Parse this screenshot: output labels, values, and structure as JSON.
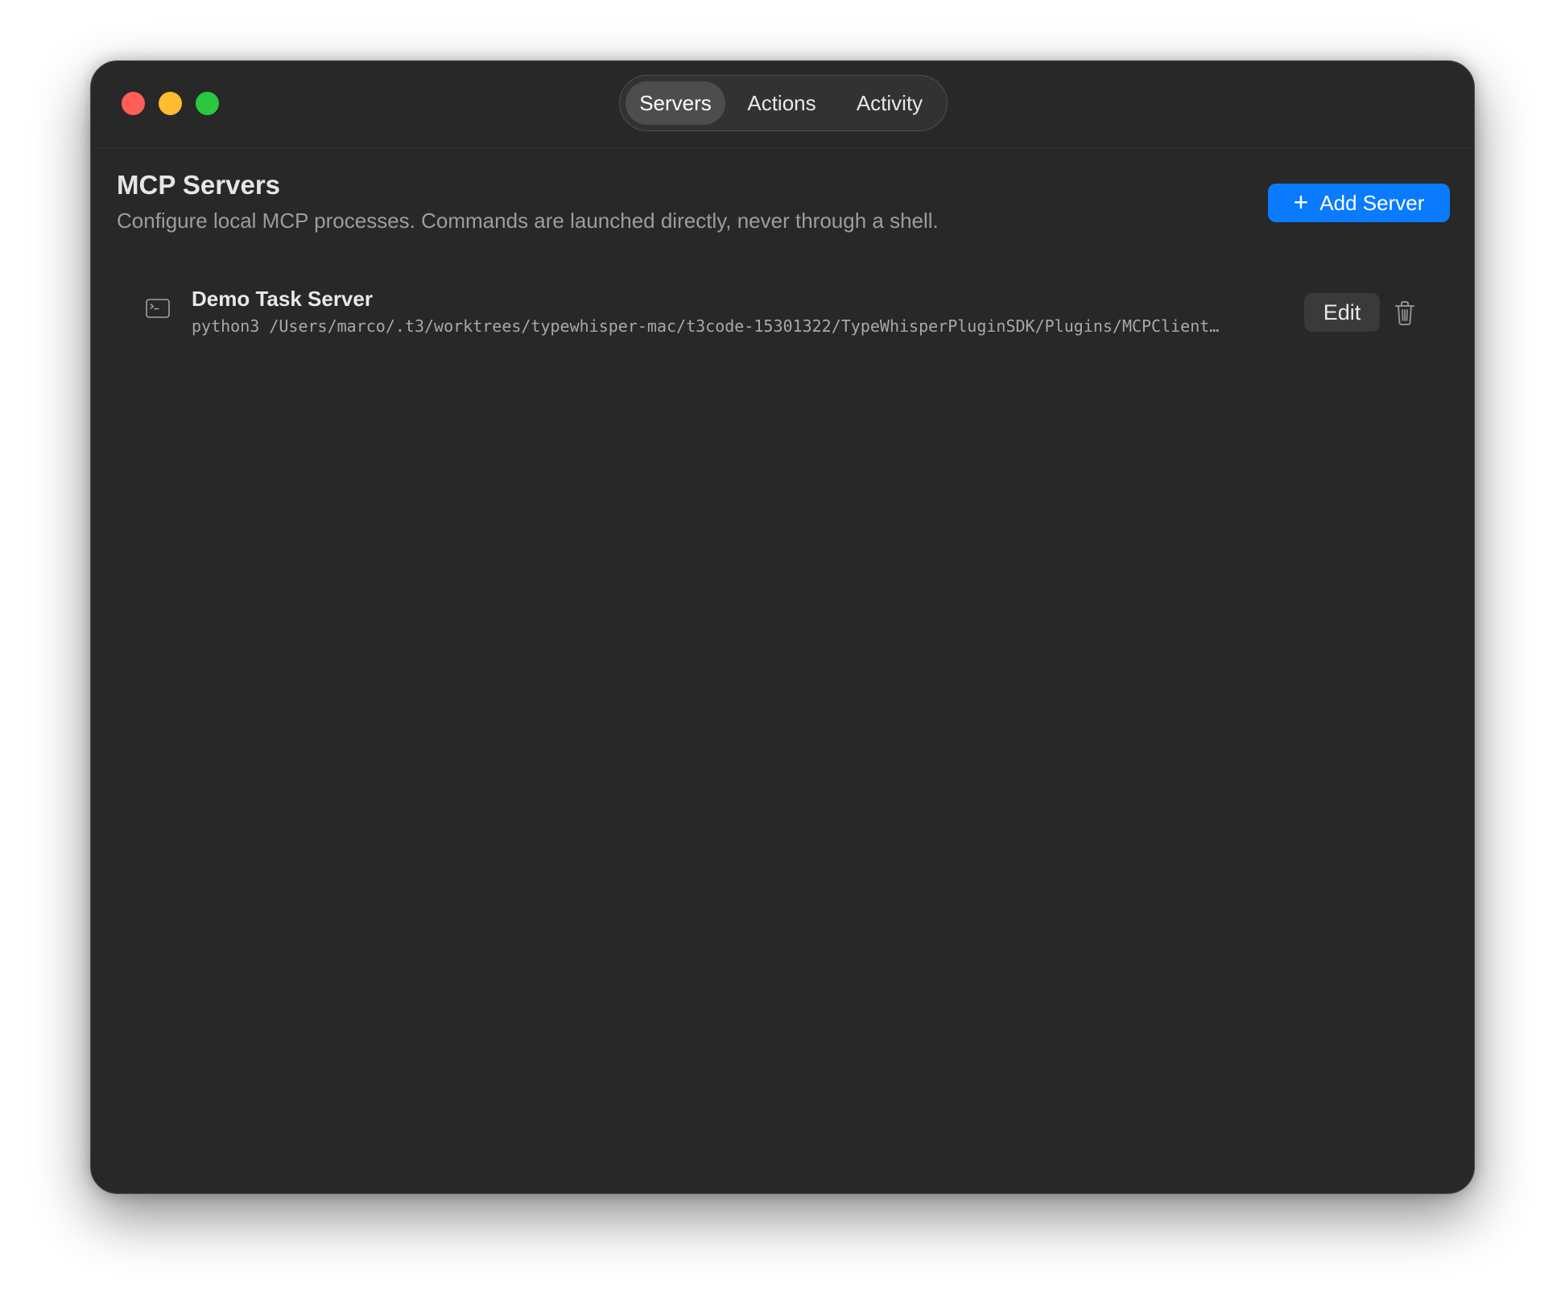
{
  "window": {
    "controls": [
      "close",
      "minimize",
      "zoom"
    ]
  },
  "tabs": [
    {
      "label": "Servers",
      "active": true
    },
    {
      "label": "Actions",
      "active": false
    },
    {
      "label": "Activity",
      "active": false
    }
  ],
  "header": {
    "title": "MCP Servers",
    "subtitle": "Configure local MCP processes. Commands are launched directly, never through a shell.",
    "add_button_label": "Add Server",
    "add_button_icon": "plus-icon"
  },
  "servers": [
    {
      "icon": "terminal-icon",
      "name": "Demo Task Server",
      "command": "python3 /Users/marco/.t3/worktrees/typewhisper-mac/t3code-15301322/TypeWhisperPluginSDK/Plugins/MCPClient…",
      "edit_label": "Edit",
      "delete_icon": "trash-icon"
    }
  ],
  "colors": {
    "window_bg": "#282828",
    "accent": "#0a7aff",
    "close": "#ff5f57",
    "minimize": "#febc2e",
    "zoom": "#28c840"
  }
}
